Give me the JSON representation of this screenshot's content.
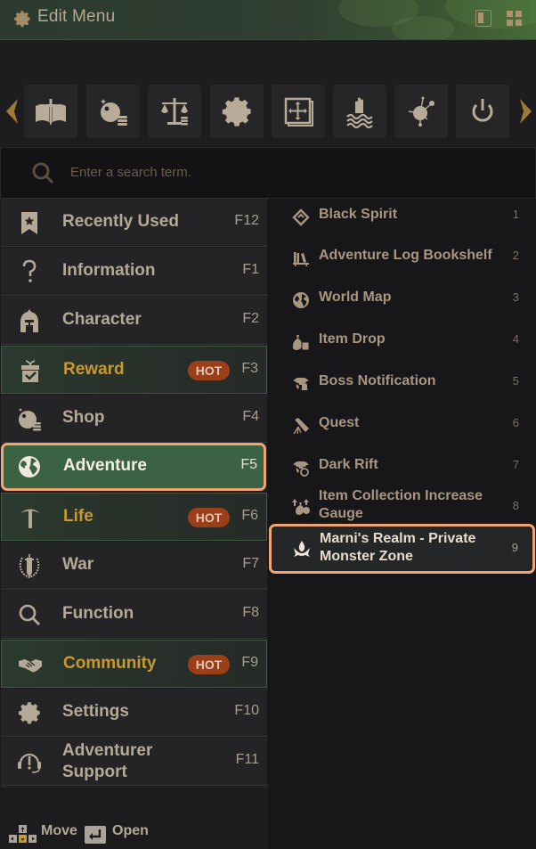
{
  "header": {
    "title": "Edit Menu",
    "icons": [
      "gear-icon",
      "single-panel-icon",
      "grid-layout-icon"
    ]
  },
  "toolbar": {
    "buttons": [
      {
        "name": "adventure-book-sword",
        "icon": "book-sword-icon"
      },
      {
        "name": "shop",
        "icon": "pearl-coins-icon"
      },
      {
        "name": "market",
        "icon": "scales-coins-icon"
      },
      {
        "name": "settings",
        "icon": "gear-icon"
      },
      {
        "name": "move-ui",
        "icon": "move-frame-icon"
      },
      {
        "name": "water",
        "icon": "hand-waves-icon"
      },
      {
        "name": "network",
        "icon": "nodes-icon"
      },
      {
        "name": "power",
        "icon": "power-icon"
      }
    ]
  },
  "search": {
    "placeholder": "Enter a search term.",
    "value": ""
  },
  "categories": [
    {
      "label": "Recently Used",
      "key": "F12",
      "icon": "bookmark-star-icon",
      "hot": false,
      "active": false
    },
    {
      "label": "Information",
      "key": "F1",
      "icon": "question-icon",
      "hot": false,
      "active": false
    },
    {
      "label": "Character",
      "key": "F2",
      "icon": "helmet-icon",
      "hot": false,
      "active": false
    },
    {
      "label": "Reward",
      "key": "F3",
      "icon": "gift-check-icon",
      "hot": true,
      "active": false
    },
    {
      "label": "Shop",
      "key": "F4",
      "icon": "pearl-coins-icon",
      "hot": false,
      "active": false
    },
    {
      "label": "Adventure",
      "key": "F5",
      "icon": "globe-icon",
      "hot": false,
      "active": true
    },
    {
      "label": "Life",
      "key": "F6",
      "icon": "pickaxe-icon",
      "hot": true,
      "active": false
    },
    {
      "label": "War",
      "key": "F7",
      "icon": "sword-laurel-icon",
      "hot": false,
      "active": false
    },
    {
      "label": "Function",
      "key": "F8",
      "icon": "search-icon",
      "hot": false,
      "active": false
    },
    {
      "label": "Community",
      "key": "F9",
      "icon": "handshake-icon",
      "hot": true,
      "active": false
    },
    {
      "label": "Settings",
      "key": "F10",
      "icon": "gear-icon",
      "hot": false,
      "active": false
    },
    {
      "label": "Adventurer Support",
      "key": "F11",
      "icon": "headset-alert-icon",
      "hot": false,
      "active": false
    }
  ],
  "hot_badge": "HOT",
  "items": [
    {
      "label": "Black Spirit",
      "num": "1",
      "icon": "diamond-spirit-icon"
    },
    {
      "label": "Adventure Log Bookshelf",
      "num": "2",
      "icon": "bookshelf-icon"
    },
    {
      "label": "World Map",
      "num": "3",
      "icon": "globe-icon"
    },
    {
      "label": "Item Drop",
      "num": "4",
      "icon": "loot-bag-icon"
    },
    {
      "label": "Boss Notification",
      "num": "5",
      "icon": "boss-bell-icon"
    },
    {
      "label": "Quest",
      "num": "6",
      "icon": "scroll-icon"
    },
    {
      "label": "Dark Rift",
      "num": "7",
      "icon": "boss-rift-icon"
    },
    {
      "label": "Item Collection Increase Gauge",
      "num": "8",
      "icon": "loot-up-icon"
    },
    {
      "label": "Marni's Realm - Private Monster Zone",
      "num": "9",
      "icon": "realm-flame-icon",
      "selected": true
    }
  ],
  "footer": {
    "move_label": "Move",
    "open_label": "Open"
  },
  "colors": {
    "accent_highlight": "#f0a571",
    "active_bg": "#3b6343",
    "hot_badge_bg": "#9a3f18",
    "hot_label": "#c99930",
    "text": "#b4a994"
  }
}
